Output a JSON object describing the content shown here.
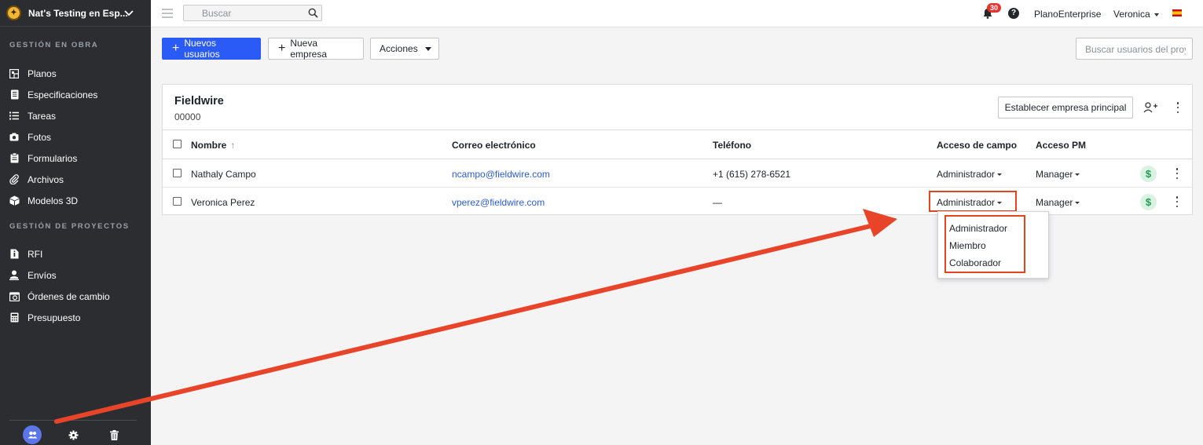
{
  "sidebar": {
    "project_name": "Nat's Testing en Esp...",
    "section_obra": "GESTIÓN EN OBRA",
    "obra_items": [
      {
        "label": "Planos",
        "icon": "plans-icon"
      },
      {
        "label": "Especificaciones",
        "icon": "specifications-icon"
      },
      {
        "label": "Tareas",
        "icon": "tasks-list-icon"
      },
      {
        "label": "Fotos",
        "icon": "camera-icon"
      },
      {
        "label": "Formularios",
        "icon": "forms-icon"
      },
      {
        "label": "Archivos",
        "icon": "paperclip-icon"
      },
      {
        "label": "Modelos 3D",
        "icon": "cube-icon"
      }
    ],
    "section_proyectos": "GESTIÓN DE PROYECTOS",
    "proyectos_items": [
      {
        "label": "RFI",
        "icon": "rfi-document-icon"
      },
      {
        "label": "Envíos",
        "icon": "submittal-person-icon"
      },
      {
        "label": "Órdenes de cambio",
        "icon": "change-order-icon"
      },
      {
        "label": "Presupuesto",
        "icon": "calculator-icon"
      }
    ]
  },
  "topbar": {
    "search_placeholder": "Buscar",
    "notifications_count": "30",
    "org_name": "PlanoEnterprise",
    "user_name": "Veronica"
  },
  "toolbar": {
    "new_users_label": "Nuevos usuarios",
    "new_company_label": "Nueva empresa",
    "actions_label": "Acciones",
    "user_search_placeholder": "Buscar usuarios del proye"
  },
  "company": {
    "name": "Fieldwire",
    "code": "00000",
    "set_main_label": "Establecer empresa principal"
  },
  "table": {
    "columns": [
      "Nombre",
      "Correo electrónico",
      "Teléfono",
      "Acceso de campo",
      "Acceso PM"
    ],
    "sort_indicator": "↑",
    "rows": [
      {
        "name": "Nathaly Campo",
        "email": "ncampo@fieldwire.com",
        "phone": "+1 (615) 278-6521",
        "field_access": "Administrador",
        "pm_access": "Manager"
      },
      {
        "name": "Veronica Perez",
        "email": "vperez@fieldwire.com",
        "phone": "—",
        "field_access": "Administrador",
        "pm_access": "Manager"
      }
    ]
  },
  "field_access_menu": {
    "options": [
      "Administrador",
      "Miembro",
      "Colaborador"
    ]
  },
  "colors": {
    "primary": "#2a5bf6",
    "sidebar_bg": "#2b2d31",
    "annotation": "#e2461f",
    "link": "#2a5bd7"
  }
}
